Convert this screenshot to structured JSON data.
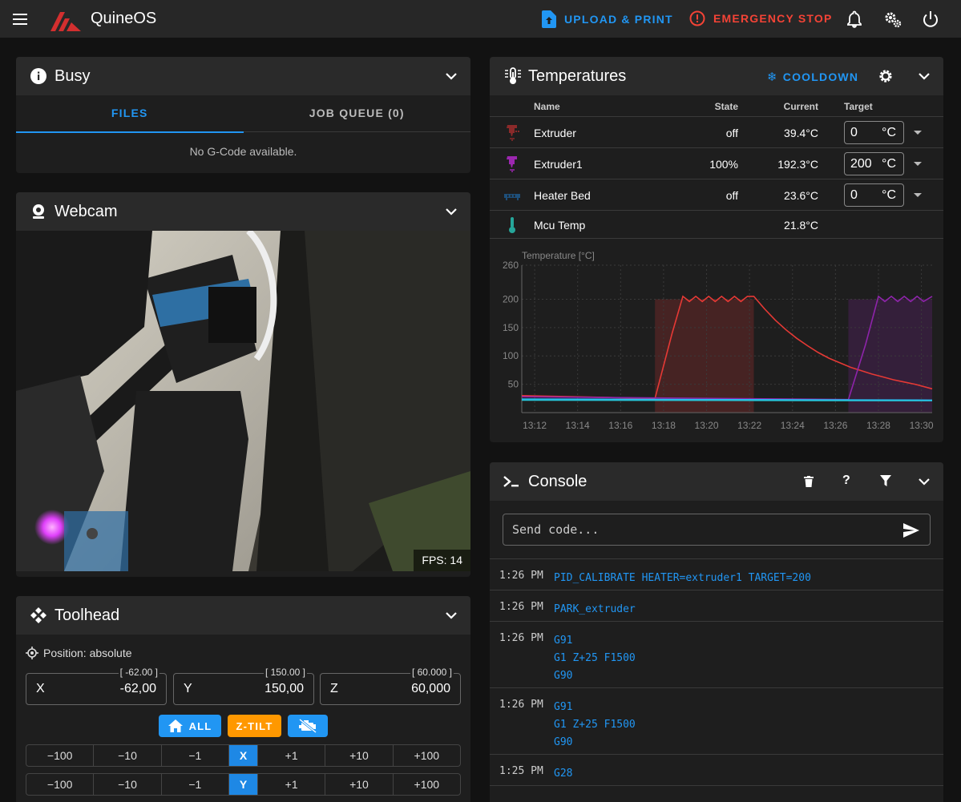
{
  "app": {
    "title": "QuineOS",
    "upload_label": "UPLOAD & PRINT",
    "estop_label": "EMERGENCY STOP",
    "colors": {
      "topbar": "#272727",
      "accent": "#2196f3",
      "danger": "#f44336",
      "brand": "#d32f2f"
    }
  },
  "busy": {
    "title": "Busy",
    "tabs": [
      {
        "label": "FILES",
        "active": true
      },
      {
        "label": "JOB QUEUE (0)",
        "active": false
      }
    ],
    "empty_text": "No G-Code available."
  },
  "webcam": {
    "title": "Webcam",
    "fps": "FPS: 14"
  },
  "toolhead": {
    "title": "Toolhead",
    "position_label": "Position: absolute",
    "axes": [
      {
        "label": "X",
        "value": "-62,00",
        "target": "[ -62.00 ]"
      },
      {
        "label": "Y",
        "value": "150,00",
        "target": "[ 150.00 ]"
      },
      {
        "label": "Z",
        "value": "60,000",
        "target": "[ 60.000 ]"
      }
    ],
    "home_all_label": "ALL",
    "ztilt_label": "Z-TILT",
    "jog_rows": [
      {
        "axis": "X",
        "neg": [
          "−100",
          "−10",
          "−1"
        ],
        "pos": [
          "+1",
          "+10",
          "+100"
        ]
      },
      {
        "axis": "Y",
        "neg": [
          "−100",
          "−10",
          "−1"
        ],
        "pos": [
          "+1",
          "+10",
          "+100"
        ]
      }
    ]
  },
  "temperatures": {
    "title": "Temperatures",
    "cooldown_label": "COOLDOWN",
    "columns": {
      "name": "Name",
      "state": "State",
      "current": "Current",
      "target": "Target"
    },
    "heaters": [
      {
        "name": "Extruder",
        "state": "off",
        "current": "39.4°C",
        "target": "0",
        "unit": "°C",
        "icon": "extruder-icon",
        "color": "#8b2a2a"
      },
      {
        "name": "Extruder1",
        "state": "100%",
        "current": "192.3°C",
        "target": "200",
        "unit": "°C",
        "icon": "extruder-icon",
        "color": "#9c27b0"
      },
      {
        "name": "Heater Bed",
        "state": "off",
        "current": "23.6°C",
        "target": "0",
        "unit": "°C",
        "icon": "radiator-icon",
        "color": "#1e4f7a"
      },
      {
        "name": "Mcu Temp",
        "state": "",
        "current": "21.8°C",
        "target": "",
        "unit": "",
        "icon": "thermometer-icon",
        "color": "#26a69a"
      }
    ]
  },
  "chart_data": {
    "type": "line",
    "ylabel": "Temperature [°C]",
    "ylim": [
      0,
      260
    ],
    "y_ticks": [
      50,
      100,
      150,
      200,
      260
    ],
    "x_ticks": [
      "13:12",
      "13:14",
      "13:16",
      "13:18",
      "13:20",
      "13:22",
      "13:24",
      "13:26",
      "13:28",
      "13:30"
    ],
    "x_range_minutes": [
      11.4,
      30.5
    ],
    "grid": true,
    "series": [
      {
        "color": "#e53935",
        "x": [
          11.4,
          17.6,
          18.4,
          18.9,
          19.2,
          19.5,
          19.8,
          20.1,
          20.4,
          20.7,
          21.0,
          21.3,
          21.6,
          21.9,
          22.2,
          22.7,
          23.2,
          23.7,
          24.2,
          24.7,
          25.2,
          25.7,
          26.2,
          26.7,
          27.2,
          27.7,
          28.2,
          28.7,
          29.2,
          29.7,
          30.5
        ],
        "y": [
          30,
          25,
          140,
          205,
          196,
          205,
          196,
          205,
          196,
          205,
          196,
          205,
          196,
          205,
          205,
          183,
          163,
          146,
          131,
          118,
          106,
          96,
          88,
          80,
          74,
          68,
          63,
          58,
          54,
          50,
          42
        ]
      },
      {
        "color": "#8e24aa",
        "x": [
          11.4,
          26.6,
          27.4,
          28.0,
          28.3,
          28.6,
          28.9,
          29.2,
          29.5,
          29.8,
          30.1,
          30.5
        ],
        "y": [
          28,
          23,
          120,
          205,
          196,
          205,
          196,
          205,
          196,
          205,
          196,
          205
        ]
      },
      {
        "color": "#29b6f6",
        "x": [
          11.4,
          30.5
        ],
        "y": [
          24,
          22
        ]
      },
      {
        "color": "#26c6da",
        "x": [
          11.4,
          30.5
        ],
        "y": [
          22,
          21
        ]
      }
    ],
    "target_bands": [
      {
        "color": "#e53935",
        "x0": 17.6,
        "x1": 22.2,
        "y": 200
      },
      {
        "color": "#8e24aa",
        "x0": 26.6,
        "x1": 30.5,
        "y": 200
      }
    ]
  },
  "console": {
    "title": "Console",
    "placeholder": "Send code...",
    "entries": [
      {
        "time": "1:26 PM",
        "lines": [
          "PID_CALIBRATE HEATER=extruder1 TARGET=200"
        ]
      },
      {
        "time": "1:26 PM",
        "lines": [
          "PARK_extruder"
        ]
      },
      {
        "time": "1:26 PM",
        "lines": [
          "G91",
          "G1 Z+25 F1500",
          "G90"
        ]
      },
      {
        "time": "1:26 PM",
        "lines": [
          "G91",
          "G1 Z+25 F1500",
          "G90"
        ]
      },
      {
        "time": "1:25 PM",
        "lines": [
          "G28"
        ]
      }
    ]
  }
}
